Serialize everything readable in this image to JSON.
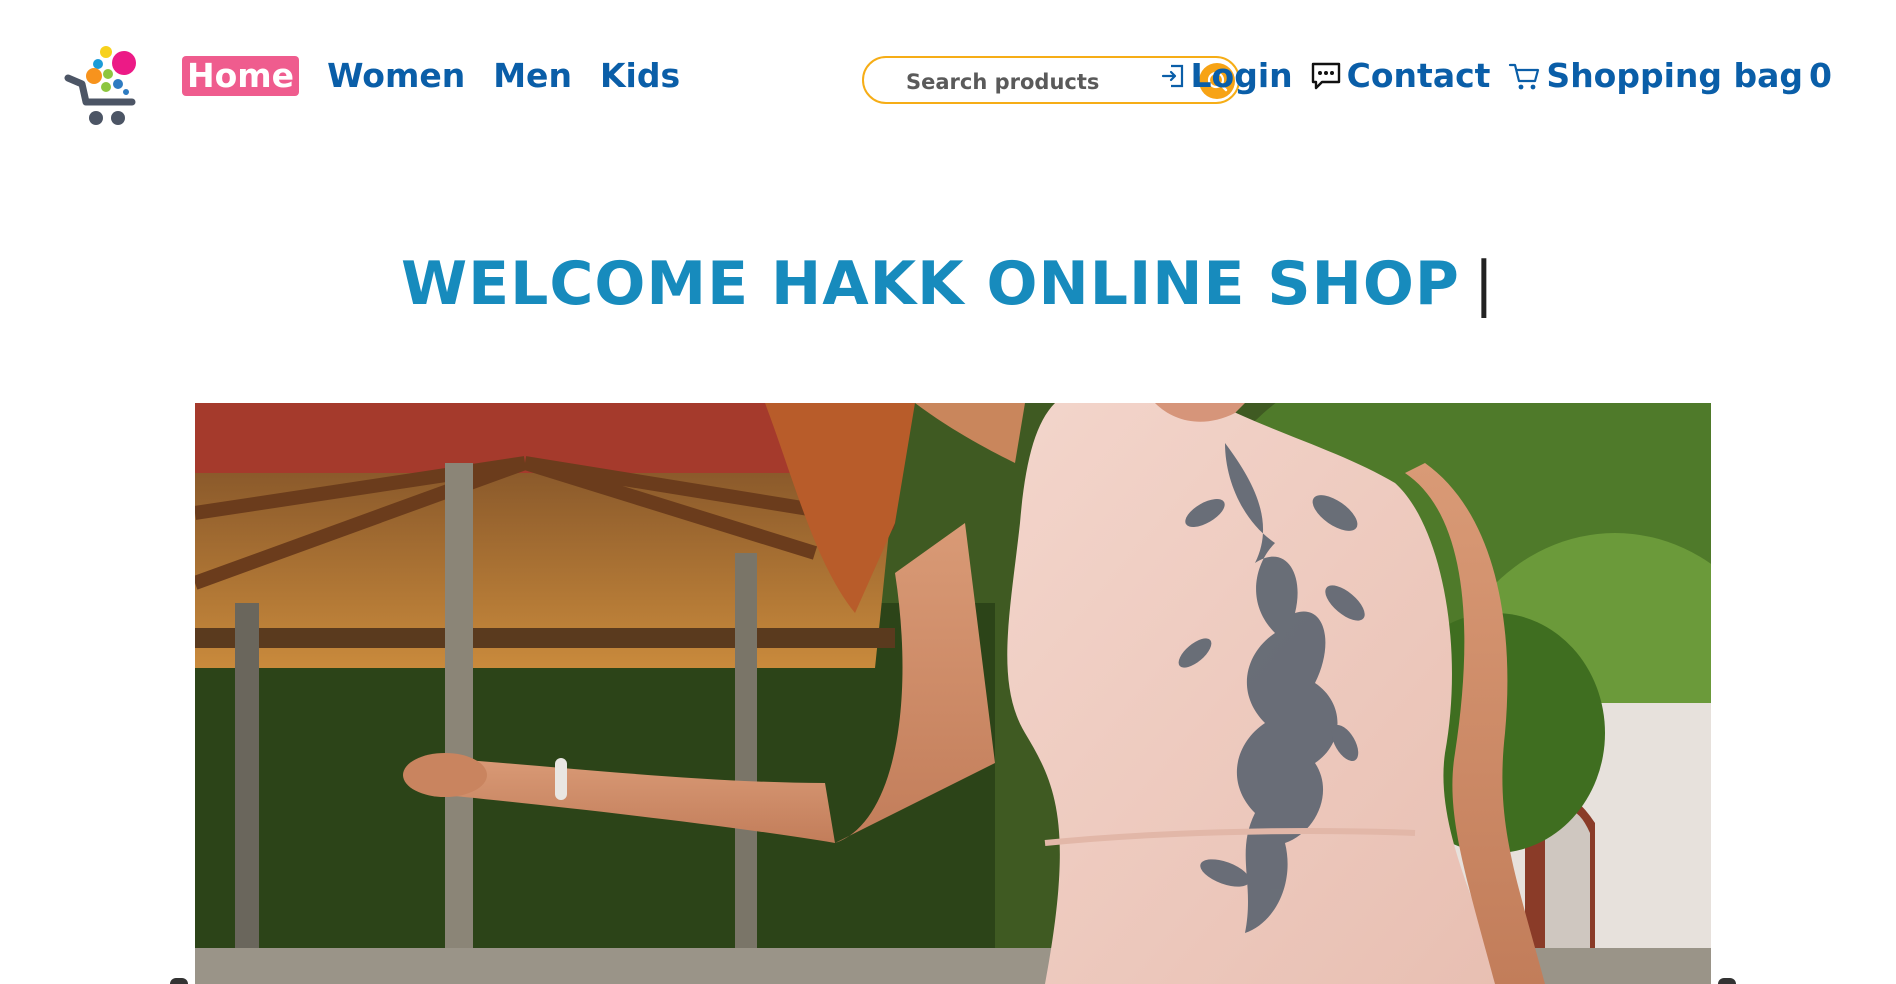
{
  "nav": {
    "items": [
      {
        "label": "Home",
        "active": true
      },
      {
        "label": "Women"
      },
      {
        "label": "Men"
      },
      {
        "label": "Kids"
      }
    ]
  },
  "search": {
    "placeholder": "Search products",
    "value": ""
  },
  "right_nav": {
    "login": "Login",
    "contact": "Contact",
    "bag_label": "Shopping bag",
    "bag_count": "0"
  },
  "hero": {
    "welcome": "WELCOME HAKK ONLINE SHOP",
    "cursor": "|"
  },
  "icons": [
    "shopping-cart-logo-icon",
    "search-icon",
    "login-icon",
    "chat-icon",
    "shopping-bag-icon",
    "slider-prev-icon",
    "slider-next-icon"
  ],
  "colors": {
    "primary": "#0a5ea8",
    "accent": "#ef5c8e",
    "search": "#f7a315",
    "welcome": "#178bbd"
  }
}
